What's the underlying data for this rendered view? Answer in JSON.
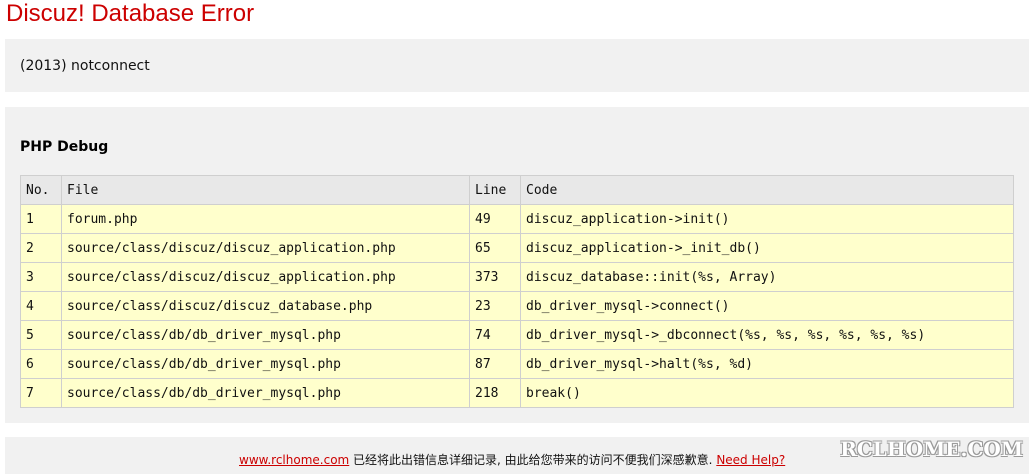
{
  "page": {
    "title": "Discuz! Database Error"
  },
  "error": {
    "message": "(2013) notconnect"
  },
  "debug": {
    "title": "PHP Debug",
    "columns": [
      "No.",
      "File",
      "Line",
      "Code"
    ],
    "rows": [
      {
        "no": "1",
        "file": "forum.php",
        "line": "49",
        "code": "discuz_application->init()"
      },
      {
        "no": "2",
        "file": "source/class/discuz/discuz_application.php",
        "line": "65",
        "code": "discuz_application->_init_db()"
      },
      {
        "no": "3",
        "file": "source/class/discuz/discuz_application.php",
        "line": "373",
        "code": "discuz_database::init(%s, Array)"
      },
      {
        "no": "4",
        "file": "source/class/discuz/discuz_database.php",
        "line": "23",
        "code": "db_driver_mysql->connect()"
      },
      {
        "no": "5",
        "file": "source/class/db/db_driver_mysql.php",
        "line": "74",
        "code": "db_driver_mysql->_dbconnect(%s, %s, %s, %s, %s, %s)"
      },
      {
        "no": "6",
        "file": "source/class/db/db_driver_mysql.php",
        "line": "87",
        "code": "db_driver_mysql->halt(%s, %d)"
      },
      {
        "no": "7",
        "file": "source/class/db/db_driver_mysql.php",
        "line": "218",
        "code": "break()"
      }
    ]
  },
  "footer": {
    "site_link": "www.rclhome.com",
    "message": " 已经将此出错信息详细记录, 由此给您带来的访问不便我们深感歉意. ",
    "help_link": "Need Help?"
  },
  "watermark": "RCLHOME.COM",
  "colors": {
    "title": "#cc0000",
    "panel": "#f1f1f1",
    "row": "#ffffcc",
    "header": "#e8e8e8",
    "link": "#cc0000"
  }
}
